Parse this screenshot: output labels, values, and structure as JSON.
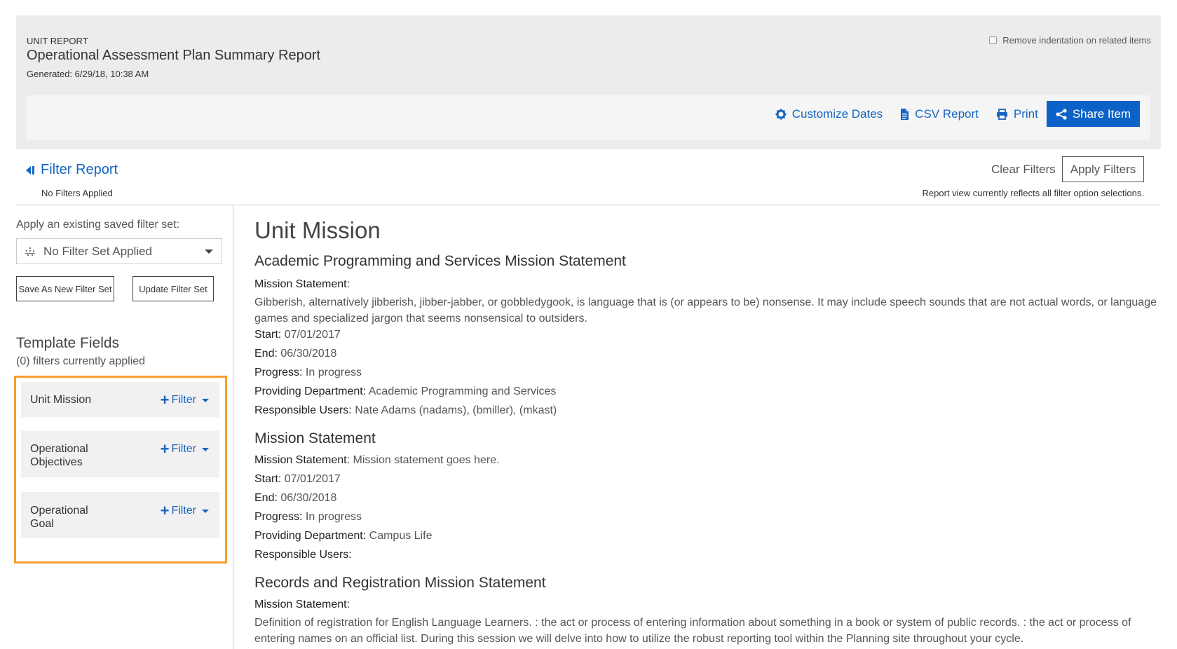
{
  "header": {
    "unit_label": "UNIT REPORT",
    "title": "Operational Assessment Plan Summary Report",
    "generated": "Generated: 6/29/18, 10:38 AM",
    "indent_option": "Remove indentation on related items"
  },
  "toolbar": {
    "customize_dates": "Customize Dates",
    "csv_report": "CSV Report",
    "print": "Print",
    "share_item": "Share Item",
    "accent_color": "#0c62c6"
  },
  "filter_bar": {
    "title": "Filter Report",
    "no_filters": "No Filters Applied",
    "clear": "Clear Filters",
    "apply": "Apply Filters",
    "reflects": "Report view currently reflects all filter option selections."
  },
  "sidebar": {
    "saved_label": "Apply an existing saved filter set:",
    "selected_filter_set": "No Filter Set Applied",
    "save_new": "Save As New Filter Set",
    "update": "Update Filter Set",
    "template_title": "Template Fields",
    "template_count": "(0) filters currently applied",
    "filter_label": "Filter",
    "items": [
      {
        "name_lines": [
          "Unit Mission"
        ]
      },
      {
        "name_lines": [
          "Operational",
          "Objectives"
        ]
      },
      {
        "name_lines": [
          "Operational",
          "Goal"
        ]
      }
    ]
  },
  "content": {
    "section_title": "Unit Mission",
    "labels": {
      "mission_statement": "Mission Statement:",
      "start": "Start:",
      "end": "End:",
      "progress": "Progress:",
      "providing_department": "Providing Department:",
      "responsible_users": "Responsible Users:"
    },
    "entries": [
      {
        "title": "Academic Programming and Services Mission Statement",
        "statement": " Gibberish, alternatively jibberish, jibber-jabber, or gobbledygook, is language that is (or appears to be) nonsense. It may include speech sounds that are not actual words, or language games and specialized jargon that seems nonsensical to outsiders.",
        "start": "07/01/2017",
        "end": "06/30/2018",
        "progress": "In progress",
        "department": "Academic Programming and Services",
        "users": "Nate Adams (nadams), (bmiller), (mkast)"
      },
      {
        "title": "Mission Statement",
        "statement": "Mission statement goes here.",
        "start": "07/01/2017",
        "end": "06/30/2018",
        "progress": "In progress",
        "department": "Campus Life",
        "users": ""
      },
      {
        "title": "Records and Registration Mission Statement",
        "statement": " Definition of registration for English Language Learners. : the act or process of entering information about something in a book or system of public records. : the act or process of entering names on an official list. During this session we will delve into how to utilize the robust reporting tool within the Planning site throughout your cycle."
      }
    ]
  }
}
